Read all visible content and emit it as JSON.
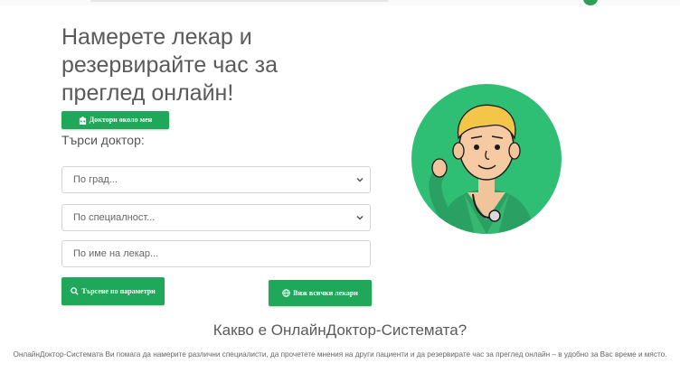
{
  "hero": {
    "title": "Намерете лекар и резервирайте час за преглед онлайн!"
  },
  "near_button": {
    "label": "Доктори около мен",
    "icon": "hospital-icon"
  },
  "search": {
    "label": "Търси доктор:",
    "city_placeholder": "По град...",
    "specialty_placeholder": "По специалност...",
    "name_placeholder": "По име на лекар...",
    "search_button": "Търсене по параметри",
    "all_button": "Виж всички лекари"
  },
  "about": {
    "title": "Какво е ОнлайнДоктор-Системата?",
    "text": "ОнлайнДоктор-Системата Ви помага да намерите различни специалисти, да прочетете мнения на други пациенти и да резервирате час за преглед онлайн – в удобно за Вас време и място."
  },
  "colors": {
    "accent": "#1fa85a",
    "illustration_bg": "#2fbf74"
  }
}
